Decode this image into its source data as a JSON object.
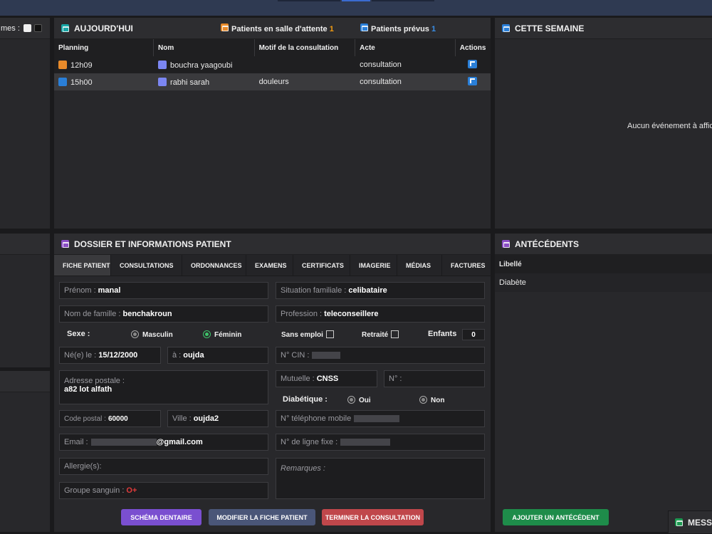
{
  "colors": {
    "accent_orange": "#f39c12",
    "accent_blue": "#2a7fd8",
    "blood_red": "#e23b3b",
    "btn_purple": "#7a4fd0",
    "btn_slate": "#4a5678",
    "btn_red": "#c0474b",
    "btn_green": "#1e8c4a"
  },
  "left_panel": {
    "header_text": "mes :"
  },
  "today": {
    "title": "AUJOURD'HUI",
    "waiting_label": "Patients en salle d'attente",
    "waiting_count": "1",
    "planned_label": "Patients prévus",
    "planned_count": "1",
    "columns": [
      "Planning",
      "Nom",
      "Motif de la consultation",
      "Acte",
      "Actions"
    ],
    "rows": [
      {
        "icon": "waiting-room-icon",
        "time": "12h09",
        "name": "bouchra yaagoubi",
        "motif": "",
        "acte": "consultation"
      },
      {
        "icon": "arrow-up-right-icon",
        "time": "15h00",
        "name": "rabhi sarah",
        "motif": "douleurs",
        "acte": "consultation"
      }
    ]
  },
  "week": {
    "title": "CETTE SEMAINE",
    "empty": "Aucun événement à affich"
  },
  "dossier": {
    "title": "DOSSIER ET INFORMATIONS PATIENT",
    "tabs": [
      "FICHE PATIENT",
      "CONSULTATIONS",
      "ORDONNANCES",
      "EXAMENS",
      "CERTIFICATS",
      "IMAGERIE",
      "MÉDIAS",
      "FACTURES"
    ],
    "prenom_label": "Prénom :",
    "prenom": "manal",
    "situation_label": "Situation familiale :",
    "situation": "celibataire",
    "nom_label": "Nom de famille :",
    "nom": "benchakroun",
    "profession_label": "Profession :",
    "profession": "teleconseillere",
    "sexe_label": "Sexe :",
    "masculin": "Masculin",
    "feminin": "Féminin",
    "sans_emploi": "Sans emploi",
    "retraite": "Retraité",
    "enfants_label": "Enfants",
    "enfants": "0",
    "ne_label": "Né(e) le :",
    "ne": "15/12/2000",
    "a_label": "à :",
    "a": "oujda",
    "cin_label": "N° CIN :",
    "adresse_label": "Adresse postale :",
    "adresse": "a82 lot alfath",
    "mutuelle_label": "Mutuelle :",
    "mutuelle": "CNSS",
    "num_label": "N° :",
    "diabetique_label": "Diabétique :",
    "oui": "Oui",
    "non": "Non",
    "cp_label": "Code postal :",
    "cp": "60000",
    "ville_label": "Ville :",
    "ville": "oujda2",
    "tel_label": "N° téléphone mobile",
    "email_label": "Email :",
    "email_domain": "@gmail.com",
    "fixe_label": "N° de ligne fixe :",
    "allergies_label": "Allergie(s):",
    "remarques_label": "Remarques :",
    "groupe_label": "Groupe sanguin :",
    "groupe": "O+",
    "btn_schema": "SCHÉMA DENTAIRE",
    "btn_modifier": "MODIFIER LA FICHE PATIENT",
    "btn_terminer": "TERMINER LA CONSULTATION"
  },
  "antecedents": {
    "title": "ANTÉCÉDENTS",
    "column": "Libellé",
    "rows": [
      "Diabète"
    ],
    "btn_add": "AJOUTER UN ANTÉCÉDENT"
  },
  "messages": {
    "title": "MESS"
  }
}
